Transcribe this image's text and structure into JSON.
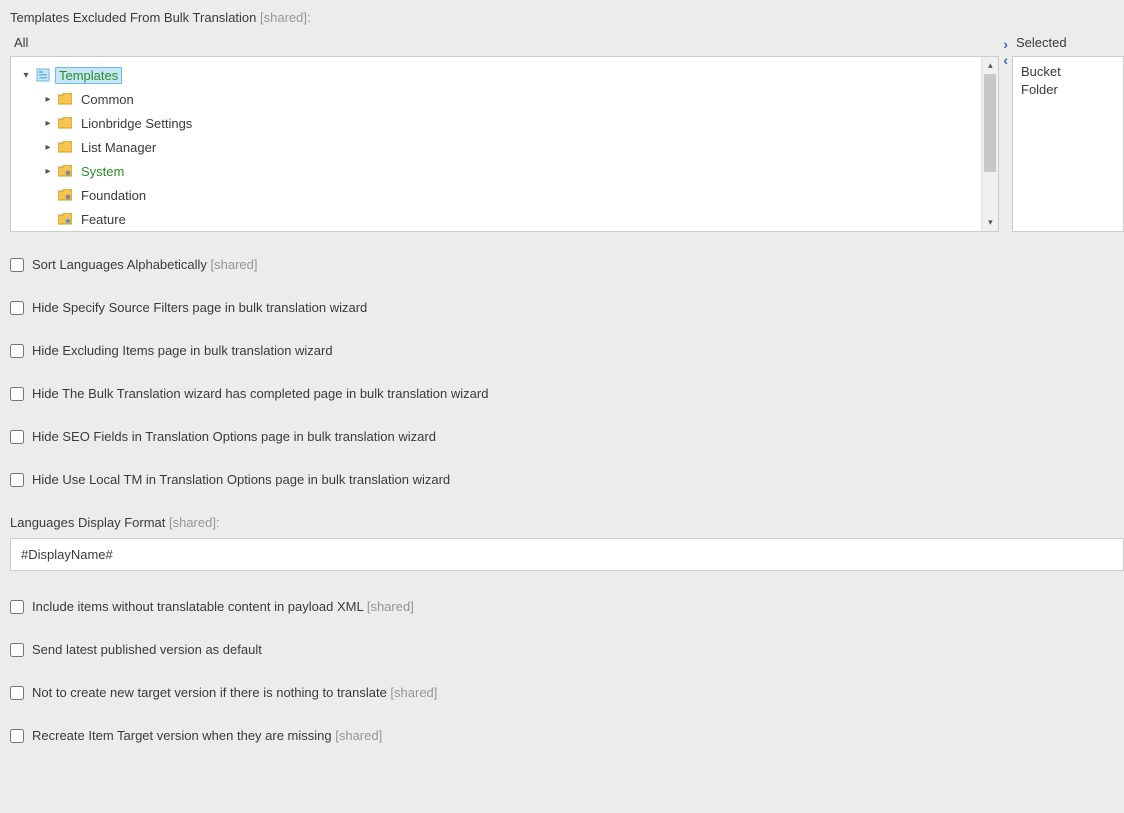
{
  "header": {
    "label": "Templates Excluded From Bulk Translation",
    "shared_suffix": " [shared]:"
  },
  "leftColumn": {
    "header": "All",
    "tree": {
      "root": {
        "label": "Templates"
      },
      "children": [
        {
          "label": "Common",
          "expandable": true
        },
        {
          "label": "Lionbridge Settings",
          "expandable": true
        },
        {
          "label": "List Manager",
          "expandable": true
        },
        {
          "label": "System",
          "expandable": true,
          "green": true
        },
        {
          "label": "Foundation",
          "expandable": false
        },
        {
          "label": "Feature",
          "expandable": false
        }
      ]
    }
  },
  "rightColumn": {
    "header": "Selected",
    "items": [
      "Bucket",
      "Folder"
    ]
  },
  "checkboxes": {
    "sort_lang": {
      "label": "Sort Languages Alphabetically",
      "shared": " [shared]"
    },
    "hide_source_filters": {
      "label": "Hide Specify Source Filters page in bulk translation wizard"
    },
    "hide_excluding": {
      "label": "Hide Excluding Items page in bulk translation wizard"
    },
    "hide_completed": {
      "label": "Hide The Bulk Translation wizard has completed page in bulk translation wizard"
    },
    "hide_seo": {
      "label": "Hide SEO Fields in Translation Options page in bulk translation wizard"
    },
    "hide_local_tm": {
      "label": "Hide Use Local TM in Translation Options page in bulk translation wizard"
    },
    "include_payload": {
      "label": "Include items without translatable content in payload XML",
      "shared": " [shared]"
    },
    "send_latest": {
      "label": "Send latest published version as default"
    },
    "not_create": {
      "label": "Not to create new target version if there is nothing to translate",
      "shared": " [shared]"
    },
    "recreate_target": {
      "label": "Recreate Item Target version when they are missing",
      "shared": " [shared]"
    }
  },
  "display_format": {
    "label": "Languages Display Format",
    "shared": " [shared]:",
    "value": "#DisplayName#"
  }
}
